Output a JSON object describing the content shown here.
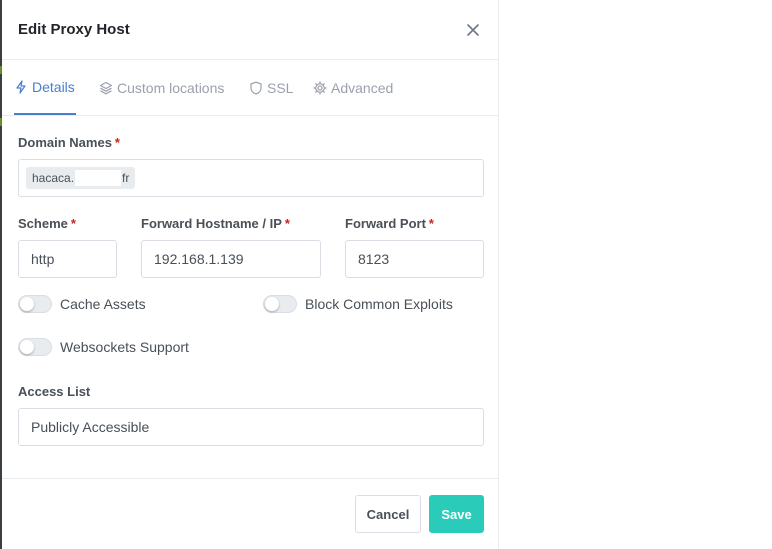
{
  "modal": {
    "title": "Edit Proxy Host",
    "close_icon": "close-icon"
  },
  "tabs": [
    {
      "label": "Details",
      "icon": "bolt-icon",
      "active": true
    },
    {
      "label": "Custom locations",
      "icon": "layers-icon",
      "active": false
    },
    {
      "label": "SSL",
      "icon": "shield-icon",
      "active": false
    },
    {
      "label": "Advanced",
      "icon": "gear-icon",
      "active": false
    }
  ],
  "form": {
    "domain_names": {
      "label": "Domain Names",
      "required": "*",
      "chip_prefix": "hacaca.",
      "chip_suffix": "fr"
    },
    "scheme": {
      "label": "Scheme",
      "required": "*",
      "value": "http"
    },
    "forward_hostname": {
      "label": "Forward Hostname / IP",
      "required": "*",
      "value": "192.168.1.139"
    },
    "forward_port": {
      "label": "Forward Port",
      "required": "*",
      "value": "8123"
    },
    "toggles": {
      "cache_assets": {
        "label": "Cache Assets",
        "on": false
      },
      "block_exploits": {
        "label": "Block Common Exploits",
        "on": false
      },
      "websockets": {
        "label": "Websockets Support",
        "on": false
      }
    },
    "access_list": {
      "label": "Access List",
      "value": "Publicly Accessible"
    }
  },
  "footer": {
    "cancel_label": "Cancel",
    "save_label": "Save"
  },
  "colors": {
    "accent": "#467fcf",
    "save": "#2bcbba",
    "required": "#cd201f"
  }
}
